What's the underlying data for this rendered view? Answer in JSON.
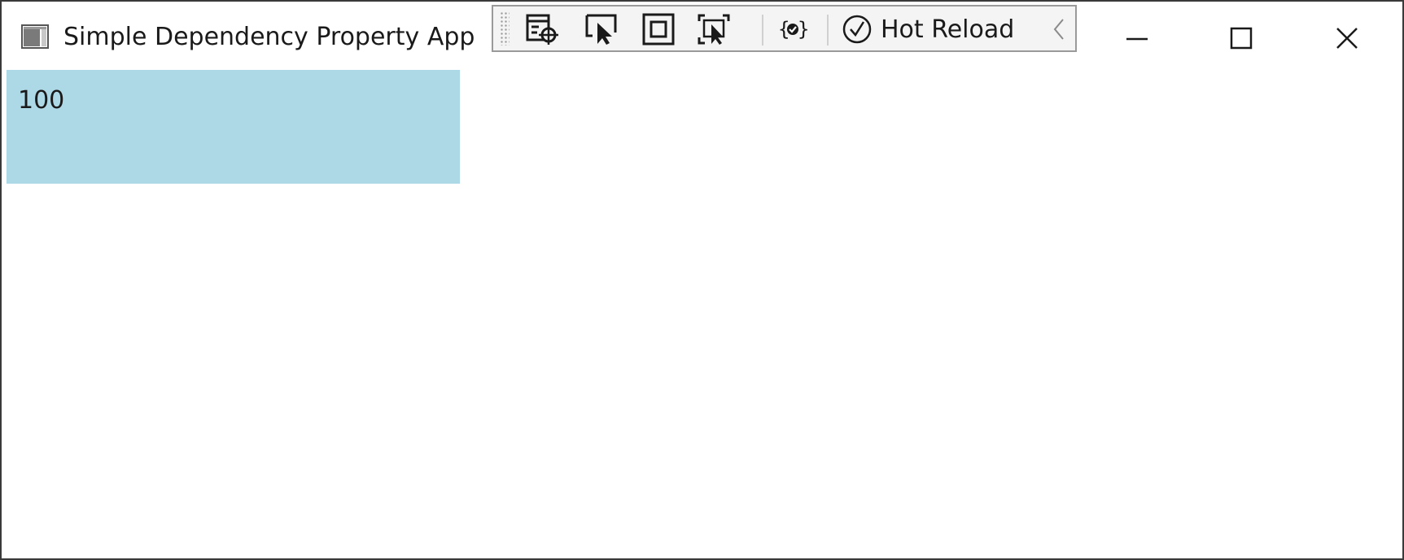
{
  "window": {
    "title": "Simple Dependency Property App",
    "icon": "app-window-icon"
  },
  "debug_toolbar": {
    "buttons": [
      {
        "name": "live-visual-tree-icon",
        "tooltip": ""
      },
      {
        "name": "select-element-icon",
        "tooltip": ""
      },
      {
        "name": "display-layout-adorners-icon",
        "tooltip": ""
      },
      {
        "name": "track-focus-icon",
        "tooltip": ""
      },
      {
        "name": "binding-failures-icon",
        "tooltip": ""
      }
    ],
    "hot_reload_label": "Hot Reload",
    "hot_reload_status_icon": "checkmark-circle-icon",
    "collapse_icon": "chevron-left-icon"
  },
  "window_controls": {
    "minimize_icon": "minimize-icon",
    "maximize_icon": "maximize-icon",
    "close_icon": "close-icon"
  },
  "content": {
    "value": "100",
    "box_color": "#add8e6"
  }
}
